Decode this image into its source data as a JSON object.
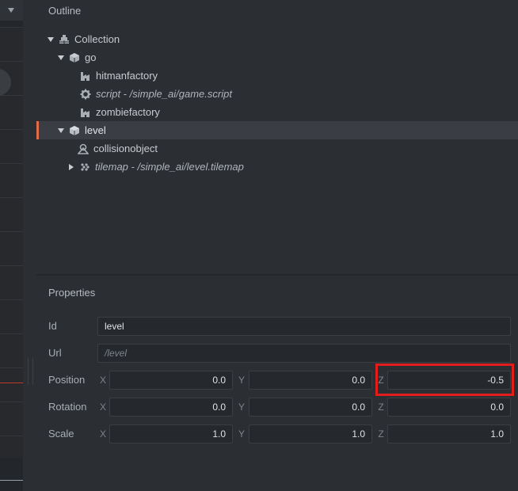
{
  "outline": {
    "title": "Outline",
    "items": [
      {
        "label": "Collection",
        "icon": "collection-icon",
        "expander": "expanded"
      },
      {
        "label": "go",
        "icon": "game-object-icon",
        "expander": "expanded"
      },
      {
        "label": "hitmanfactory",
        "icon": "factory-icon"
      },
      {
        "label": "script - /simple_ai/game.script",
        "icon": "gear-icon",
        "style": "italic"
      },
      {
        "label": "zombiefactory",
        "icon": "factory-icon"
      },
      {
        "label": "level",
        "icon": "game-object-icon",
        "expander": "expanded",
        "selected": true
      },
      {
        "label": "collisionobject",
        "icon": "collision-object-icon"
      },
      {
        "label": "tilemap - /simple_ai/level.tilemap",
        "icon": "tilemap-icon",
        "expander": "collapsed",
        "style": "italic"
      }
    ]
  },
  "properties": {
    "title": "Properties",
    "id": {
      "label": "Id",
      "value": "level"
    },
    "url": {
      "label": "Url",
      "placeholder": "/level"
    },
    "position": {
      "label": "Position",
      "x": "0.0",
      "y": "0.0",
      "z": "-0.5"
    },
    "rotation": {
      "label": "Rotation",
      "x": "0.0",
      "y": "0.0",
      "z": "0.0"
    },
    "scale": {
      "label": "Scale",
      "x": "1.0",
      "y": "1.0",
      "z": "1.0"
    },
    "axes": {
      "x": "X",
      "y": "Y",
      "z": "Z"
    }
  },
  "colors": {
    "selection_accent": "#e06c4a",
    "highlight_box": "#e11d1d"
  }
}
